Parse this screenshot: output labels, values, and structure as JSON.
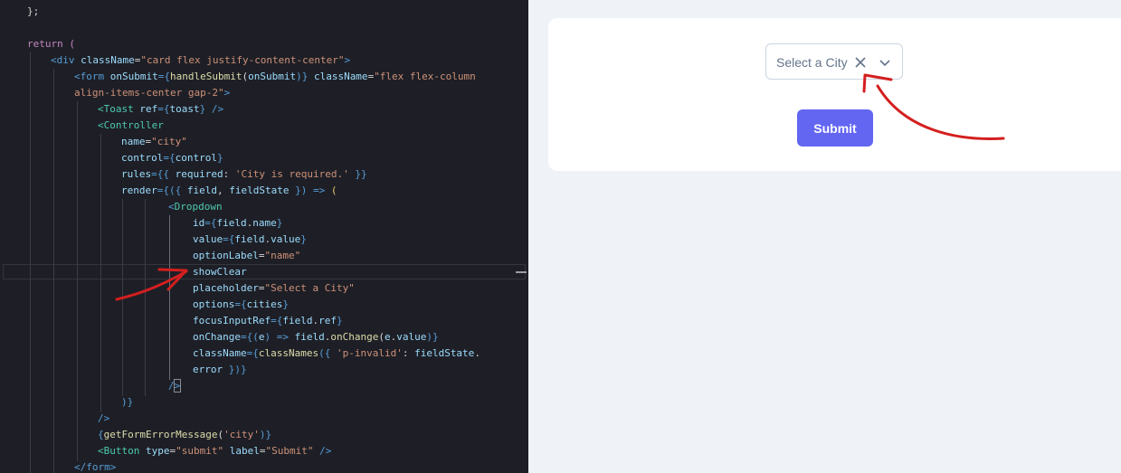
{
  "code": {
    "l0": "};",
    "l2": "return (",
    "l3a": "<div",
    "l3b": "className",
    "l3c": "=",
    "l3d": "\"card flex justify-content-center\"",
    "l3e": ">",
    "l4a": "<form",
    "l4b": "onSubmit",
    "l4c": "={",
    "l4d": "handleSubmit",
    "l4e": "(",
    "l4f": "onSubmit",
    "l4g": ")}",
    "l4h": "className",
    "l4i": "=",
    "l4j": "\"flex flex-column",
    "l5a": "align-items-center gap-2\"",
    "l5b": ">",
    "l6a": "<Toast",
    "l6b": "ref",
    "l6c": "={",
    "l6d": "toast",
    "l6e": "}",
    "l6f": "/>",
    "l7a": "<Controller",
    "l8a": "name",
    "l8b": "=",
    "l8c": "\"city\"",
    "l9a": "control",
    "l9b": "={",
    "l9c": "control",
    "l9d": "}",
    "l10a": "rules",
    "l10b": "={{",
    "l10c": "required",
    "l10d": ":",
    "l10e": "'City is required.'",
    "l10f": "}}",
    "l11a": "render",
    "l11b": "={({",
    "l11c": "field",
    "l11d": ",",
    "l11e": "fieldState",
    "l11f": "})",
    "l11g": "=>",
    "l11h": "(",
    "l12a": "<",
    "l12b": "Dropdown",
    "l13a": "id",
    "l13b": "={",
    "l13c": "field",
    "l13d": ".",
    "l13e": "name",
    "l13f": "}",
    "l14a": "value",
    "l14b": "={",
    "l14c": "field",
    "l14d": ".",
    "l14e": "value",
    "l14f": "}",
    "l15a": "optionLabel",
    "l15b": "=",
    "l15c": "\"name\"",
    "l16a": "showClear",
    "l17a": "placeholder",
    "l17b": "=",
    "l17c": "\"Select a City\"",
    "l18a": "options",
    "l18b": "={",
    "l18c": "cities",
    "l18d": "}",
    "l19a": "focusInputRef",
    "l19b": "={",
    "l19c": "field",
    "l19d": ".",
    "l19e": "ref",
    "l19f": "}",
    "l20a": "onChange",
    "l20b": "={(",
    "l20c": "e",
    "l20d": ")",
    "l20e": "=>",
    "l20f": "field",
    "l20g": ".",
    "l20h": "onChange",
    "l20i": "(",
    "l20j": "e",
    "l20k": ".",
    "l20l": "value",
    "l20m": ")}",
    "l21a": "className",
    "l21b": "={",
    "l21c": "classNames",
    "l21d": "({",
    "l21e": "'p-invalid'",
    "l21f": ":",
    "l21g": "fieldState",
    "l21h": ".",
    "l22a": "error",
    "l22b": "})}",
    "l23a": "/",
    "l23b": ">",
    "l24a": ")}",
    "l25a": "/>",
    "l26a": "{",
    "l26b": "getFormErrorMessage",
    "l26c": "(",
    "l26d": "'city'",
    "l26e": ")}",
    "l27a": "<Button",
    "l27b": "type",
    "l27c": "=",
    "l27d": "\"submit\"",
    "l27e": "label",
    "l27f": "=",
    "l27g": "\"Submit\"",
    "l27h": "/>",
    "l28a": "</form>"
  },
  "preview": {
    "dropdown_placeholder": "Select a City",
    "clear_icon": "times-icon",
    "trigger_icon": "chevron-down-icon",
    "submit_label": "Submit",
    "accent_color": "#6366f1"
  },
  "annotation_color": "#d41f1f"
}
